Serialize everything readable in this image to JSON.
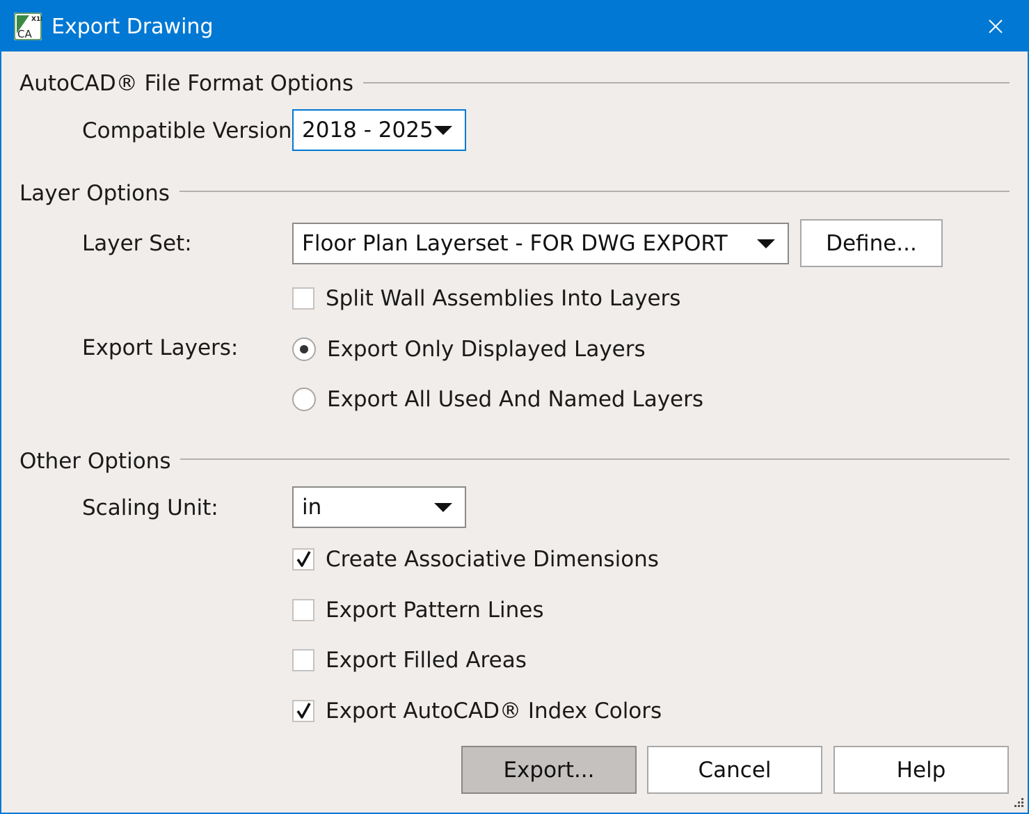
{
  "window": {
    "title": "Export Drawing",
    "icon_name": "chief-architect-x18-app-icon",
    "icon_badge": "X18",
    "icon_letters": "CA",
    "accent_color": "#0078d4"
  },
  "autocad_group": {
    "label": "AutoCAD® File Format Options",
    "compatible_version_label": "Compatible Version:",
    "compatible_version_value": "2018 - 2025"
  },
  "layer_group": {
    "label": "Layer Options",
    "layer_set_label": "Layer Set:",
    "layer_set_value": "Floor Plan Layerset - FOR DWG EXPORT",
    "define_button": "Define...",
    "split_wall_label": "Split Wall Assemblies Into Layers",
    "split_wall_checked": false,
    "export_layers_label": "Export Layers:",
    "export_layers_options": [
      {
        "label": "Export Only Displayed Layers",
        "selected": true
      },
      {
        "label": "Export All Used And Named Layers",
        "selected": false
      }
    ]
  },
  "other_group": {
    "label": "Other Options",
    "scaling_unit_label": "Scaling Unit:",
    "scaling_unit_value": "in",
    "checkboxes": [
      {
        "label": "Create Associative Dimensions",
        "checked": true
      },
      {
        "label": "Export Pattern Lines",
        "checked": false
      },
      {
        "label": "Export Filled Areas",
        "checked": false
      },
      {
        "label": "Export AutoCAD® Index Colors",
        "checked": true
      }
    ]
  },
  "buttons": {
    "export": "Export...",
    "cancel": "Cancel",
    "help": "Help"
  }
}
